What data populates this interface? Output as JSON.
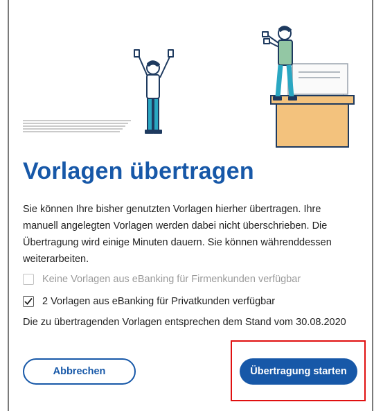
{
  "dialog": {
    "title": "Vorlagen übertragen",
    "description": "Sie können Ihre bisher genutzten Vorlagen hierher übertragen. Ihre manuell angelegten Vorlagen werden dabei nicht überschrieben. Die Übertragung wird einige Minuten dauern. Sie können währenddessen weiterarbeiten.",
    "options": [
      {
        "label": "Keine Vorlagen aus eBanking für Firmenkunden verfügbar",
        "checked": false,
        "disabled": true
      },
      {
        "label": "2 Vorlagen aus eBanking für Privatkunden verfügbar",
        "checked": true,
        "disabled": false
      }
    ],
    "stand_note": "Die zu übertragenden Vorlagen entsprechen dem Stand vom 30.08.2020"
  },
  "buttons": {
    "cancel_label": "Abbrechen",
    "start_label": "Übertragung starten"
  },
  "colors": {
    "primary": "#1758a8",
    "illustration_teal": "#2aa7c2",
    "illustration_green": "#93c7a4",
    "box_fill": "#f3c27d",
    "box_stroke": "#1e3a5f",
    "highlight": "#e01010"
  }
}
